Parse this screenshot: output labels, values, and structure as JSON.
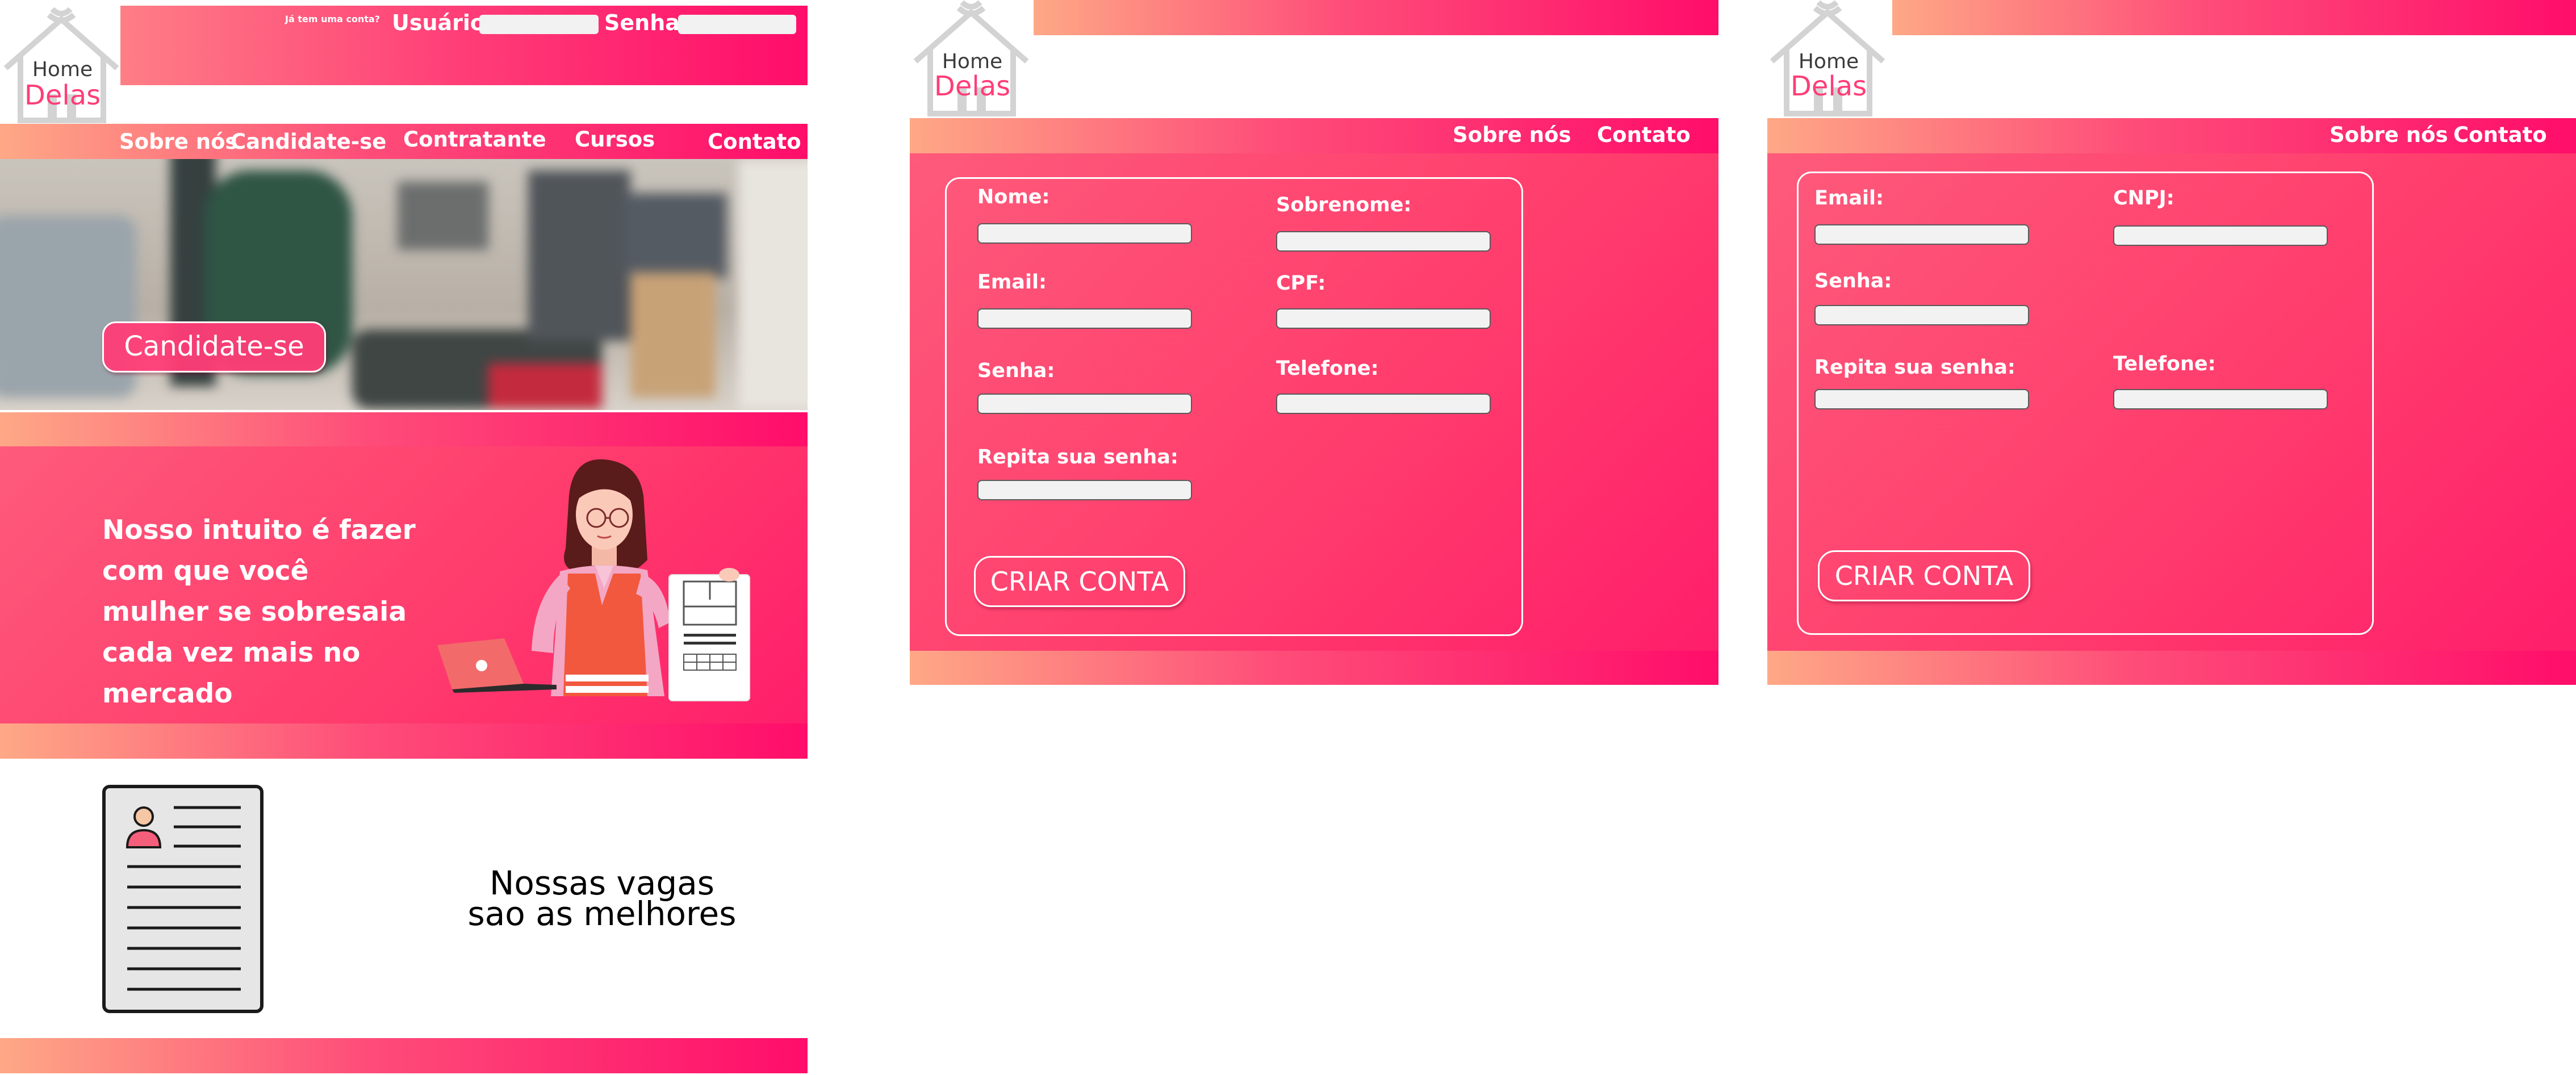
{
  "brand": {
    "home": "Home",
    "delas": "Delas"
  },
  "home_page": {
    "login_prompt": "Já tem uma conta?",
    "user_label": "Usuário",
    "password_label": "Senha",
    "nav": [
      "Sobre nós",
      "Candidate-se",
      "Contratante",
      "Cursos",
      "Contato"
    ],
    "hero_button": "Candidate-se",
    "mission_text": "Nosso intuito é fazer com que você mulher se sobresaia cada vez mais no mercado",
    "jobs_text_line1": "Nossas vagas",
    "jobs_text_line2": "sao as melhores"
  },
  "candidate_page": {
    "nav": [
      "Sobre nós",
      "Contato"
    ],
    "fields": {
      "nome": "Nome:",
      "sobrenome": "Sobrenome:",
      "email": "Email:",
      "cpf": "CPF:",
      "senha": "Senha:",
      "telefone": "Telefone:",
      "repita": "Repita sua senha:"
    },
    "submit": "CRIAR CONTA"
  },
  "company_page": {
    "nav": [
      "Sobre nós",
      "Contato"
    ],
    "fields": {
      "email": "Email:",
      "cnpj": "CNPJ:",
      "senha": "Senha:",
      "repita": "Repita sua senha:",
      "telefone": "Telefone:"
    },
    "submit": "CRIAR CONTA"
  },
  "colors": {
    "accent": "#ff3d77",
    "gradient_start": "#fea886",
    "gradient_end": "#ff0d6a"
  },
  "icons": [
    "house-logo-icon",
    "resume-document-icon",
    "worker-illustration"
  ]
}
